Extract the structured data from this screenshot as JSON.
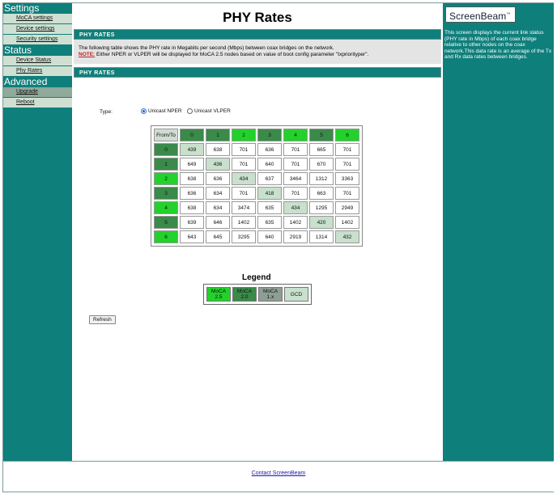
{
  "nav": {
    "sections": [
      {
        "title": "Settings",
        "items": [
          {
            "label": "MoCA settings"
          },
          {
            "label": "Device settings"
          },
          {
            "label": "Security settings"
          }
        ]
      },
      {
        "title": "Status",
        "items": [
          {
            "label": "Device Status"
          },
          {
            "label": "Phy Rates"
          }
        ]
      },
      {
        "title": "Advanced",
        "items": [
          {
            "label": "Upgrade"
          },
          {
            "label": "Reboot"
          }
        ]
      }
    ]
  },
  "page": {
    "title": "PHY Rates",
    "section1": "PHY RATES",
    "info_line1": "The following table shows the PHY rate in Megabits per second (Mbps) between coax bridges on the network.",
    "note_label": "NOTE:",
    "note_text": " Either NPER or VLPER will be displayed for MoCA 2.5 nodes based on value of boot config parameter \"txpriorityper\".",
    "section2": "PHY RATES"
  },
  "type_selector": {
    "label": "Type:",
    "options": [
      {
        "label": "Unicast NPER",
        "selected": true
      },
      {
        "label": "Unicast VLPER",
        "selected": false
      }
    ]
  },
  "rates_table": {
    "corner": "From/To",
    "nodes": [
      {
        "id": "0",
        "class": "moca20"
      },
      {
        "id": "1",
        "class": "moca20"
      },
      {
        "id": "2",
        "class": "moca25"
      },
      {
        "id": "3",
        "class": "moca20"
      },
      {
        "id": "4",
        "class": "moca25"
      },
      {
        "id": "5",
        "class": "moca20"
      },
      {
        "id": "6",
        "class": "moca25"
      }
    ],
    "rows": [
      [
        "439",
        "638",
        "701",
        "636",
        "701",
        "665",
        "701"
      ],
      [
        "649",
        "436",
        "701",
        "640",
        "701",
        "670",
        "701"
      ],
      [
        "638",
        "636",
        "434",
        "637",
        "3464",
        "1312",
        "3363"
      ],
      [
        "636",
        "634",
        "701",
        "418",
        "701",
        "663",
        "701"
      ],
      [
        "638",
        "634",
        "3474",
        "635",
        "434",
        "1295",
        "2949"
      ],
      [
        "639",
        "646",
        "1402",
        "635",
        "1402",
        "420",
        "1402"
      ],
      [
        "643",
        "645",
        "3295",
        "640",
        "2919",
        "1314",
        "432"
      ]
    ]
  },
  "legend": {
    "title": "Legend",
    "items": [
      {
        "line1": "MoCA",
        "line2": "2.5",
        "class": "moca25"
      },
      {
        "line1": "MoCA",
        "line2": "2.0",
        "class": "moca20"
      },
      {
        "line1": "MoCA",
        "line2": "1.x",
        "class": "moca1x"
      },
      {
        "line1": "GCD",
        "line2": "",
        "class": "gcd"
      }
    ]
  },
  "buttons": {
    "refresh": "Refresh"
  },
  "sidebar_right": {
    "logo": "ScreenBeam",
    "logo_mark": "™",
    "description": "This screen displays the current link status (PHY rate in Mbps) of each coax bridge relative to other nodes on the coax network.This data rate is an average of the Tx and Rx data rates between bridges."
  },
  "footer": {
    "link": "Contact ScreenBeam"
  },
  "colors": {
    "teal": "#0f7f7b",
    "moca25": "#22d22a",
    "moca20": "#3a8a4a",
    "moca1x": "#8e9e94",
    "gcd": "#c8e0cc",
    "note_red": "#c0201c"
  }
}
